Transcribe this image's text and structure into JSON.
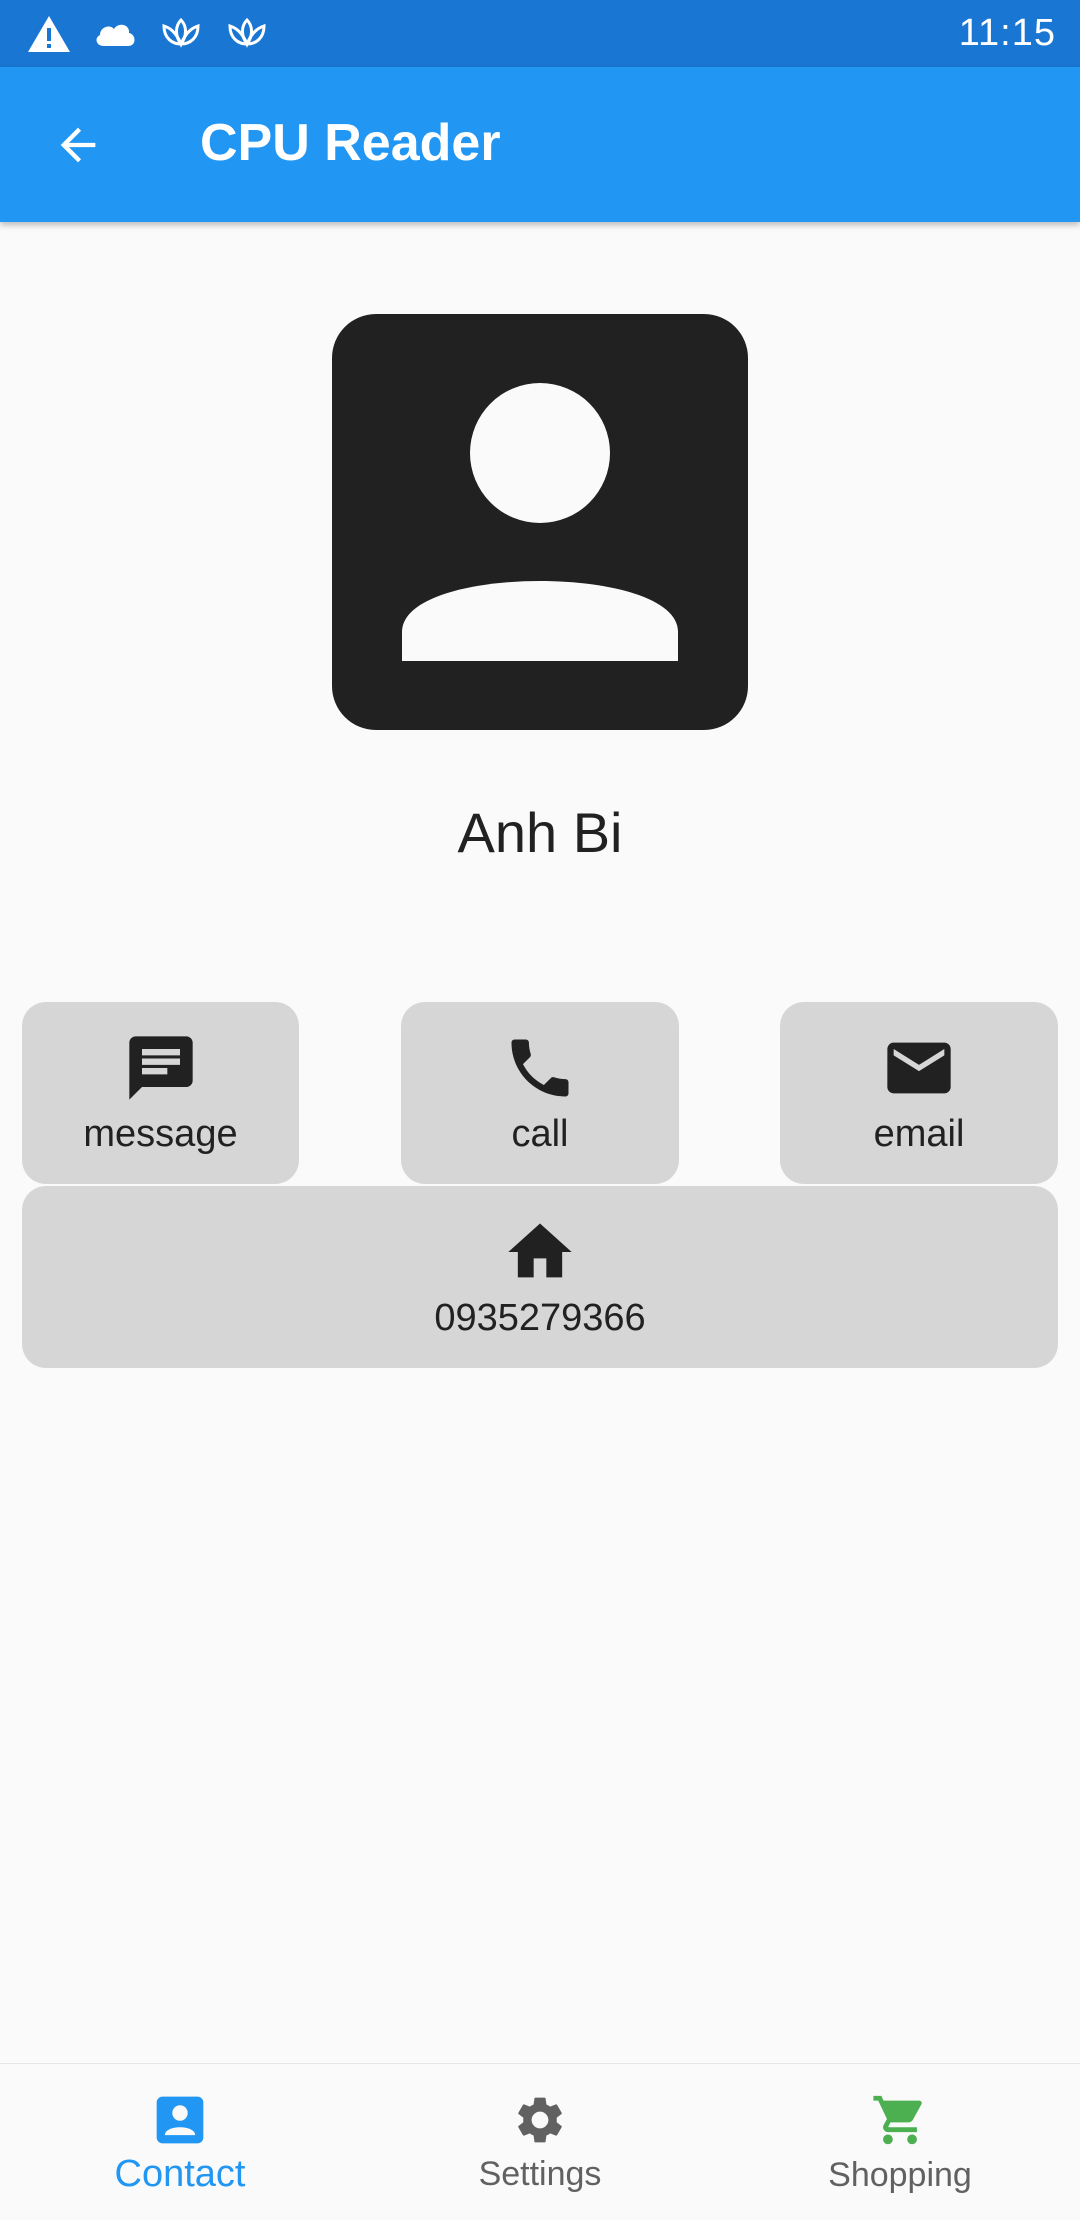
{
  "status_bar": {
    "time": "11:15",
    "icons": [
      "warning-icon",
      "cloud-icon",
      "lotus-icon",
      "lotus-icon"
    ]
  },
  "app_bar": {
    "title": "CPU Reader",
    "back_icon": "arrow-back-icon"
  },
  "contact": {
    "name": "Anh Bi",
    "avatar_icon": "person-icon"
  },
  "actions": {
    "message": {
      "label": "message",
      "icon": "message-icon"
    },
    "call": {
      "label": "call",
      "icon": "phone-icon"
    },
    "email": {
      "label": "email",
      "icon": "mail-icon"
    },
    "home": {
      "label": "0935279366",
      "icon": "home-icon"
    }
  },
  "bottom_nav": {
    "items": [
      {
        "label": "Contact",
        "icon": "contact-icon",
        "selected": true,
        "color": "#2196f3"
      },
      {
        "label": "Settings",
        "icon": "gear-icon",
        "selected": false,
        "color": "#616161"
      },
      {
        "label": "Shopping",
        "icon": "cart-icon",
        "selected": false,
        "color": "#4caf50"
      }
    ]
  },
  "colors": {
    "app_bar": "#2196f3",
    "status_bar": "#1976d2",
    "button_bg": "#d6d6d6",
    "avatar_bg": "#212121"
  }
}
